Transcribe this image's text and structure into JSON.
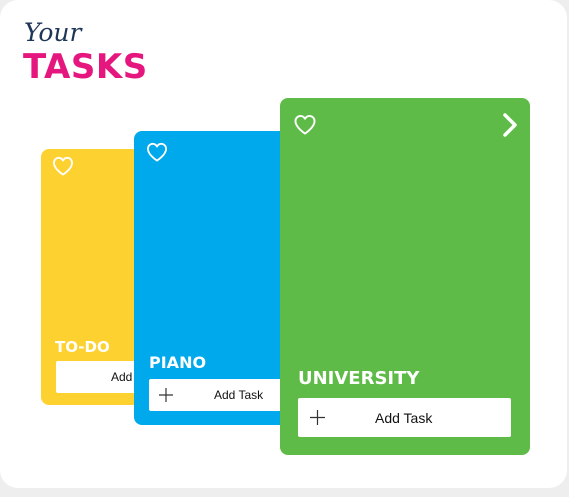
{
  "header": {
    "your_label": "Your",
    "tasks_label": "TASKS"
  },
  "colors": {
    "todo": "#fdd230",
    "piano": "#00a9ec",
    "university": "#5fbb47",
    "title_dark": "#1e3657",
    "title_accent": "#e5177e"
  },
  "cards": [
    {
      "title": "TO-DO",
      "add_label": "Add Task",
      "icon": "heart-icon"
    },
    {
      "title": "PIANO",
      "add_label": "Add Task",
      "icon": "heart-icon"
    },
    {
      "title": "UNIVERSITY",
      "add_label": "Add Task",
      "icon": "heart-icon",
      "nav_icon": "chevron-right-icon"
    }
  ]
}
